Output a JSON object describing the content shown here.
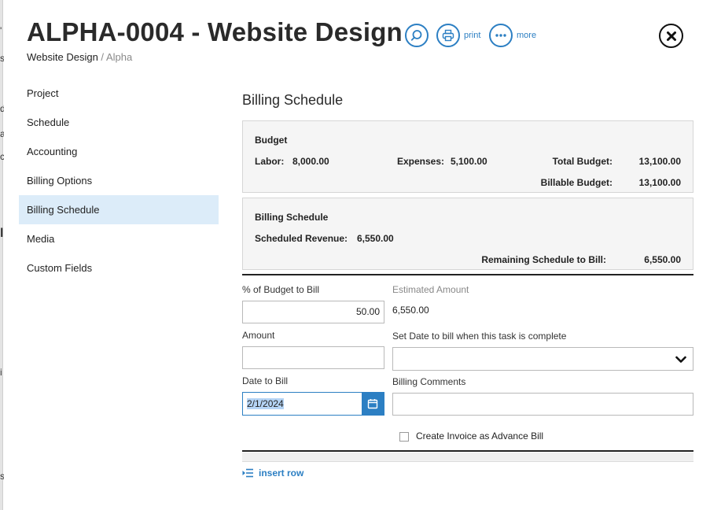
{
  "header": {
    "title": "ALPHA-0004 - Website Design",
    "breadcrumb": {
      "project": "Website Design",
      "separator": " / ",
      "client": "Alpha"
    },
    "tools": [
      {
        "icon": "search-icon",
        "label": ""
      },
      {
        "icon": "print-icon",
        "label": "print"
      },
      {
        "icon": "more-icon",
        "label": "more"
      }
    ],
    "close_icon": "close-icon"
  },
  "left_edge_fragments": [
    "'",
    "s",
    "d",
    "a",
    "c",
    "l",
    "i",
    "s"
  ],
  "nav": {
    "items": [
      {
        "label": "Project",
        "active": false
      },
      {
        "label": "Schedule",
        "active": false
      },
      {
        "label": "Accounting",
        "active": false
      },
      {
        "label": "Billing Options",
        "active": false
      },
      {
        "label": "Billing Schedule",
        "active": true
      },
      {
        "label": "Media",
        "active": false
      },
      {
        "label": "Custom Fields",
        "active": false
      }
    ]
  },
  "main": {
    "section_title": "Billing Schedule",
    "budget": {
      "heading": "Budget",
      "labor_label": "Labor:",
      "labor_value": "8,000.00",
      "expenses_label": "Expenses:",
      "expenses_value": "5,100.00",
      "total_label": "Total Budget:",
      "total_value": "13,100.00",
      "billable_label": "Billable Budget:",
      "billable_value": "13,100.00"
    },
    "schedule": {
      "heading": "Billing Schedule",
      "scheduled_label": "Scheduled Revenue:",
      "scheduled_value": "6,550.00",
      "remaining_label": "Remaining Schedule to Bill:",
      "remaining_value": "6,550.00"
    },
    "form": {
      "pct_label": "% of Budget to Bill",
      "pct_value": "50.00",
      "estimated_label": "Estimated Amount",
      "estimated_value": "6,550.00",
      "amount_label": "Amount",
      "amount_value": "",
      "task_label": "Set Date to bill when this task is complete",
      "task_value": "",
      "date_label": "Date to Bill",
      "date_value": "2/1/2024",
      "comments_label": "Billing Comments",
      "comments_value": "",
      "advance_label": "Create Invoice as Advance Bill",
      "advance_checked": false
    },
    "insert_row_label": "insert row"
  },
  "colors": {
    "accent": "#2c7fc3",
    "nav_active_bg": "#dcecf9",
    "panel_bg": "#f5f5f5",
    "selection": "#b5d4f5"
  }
}
